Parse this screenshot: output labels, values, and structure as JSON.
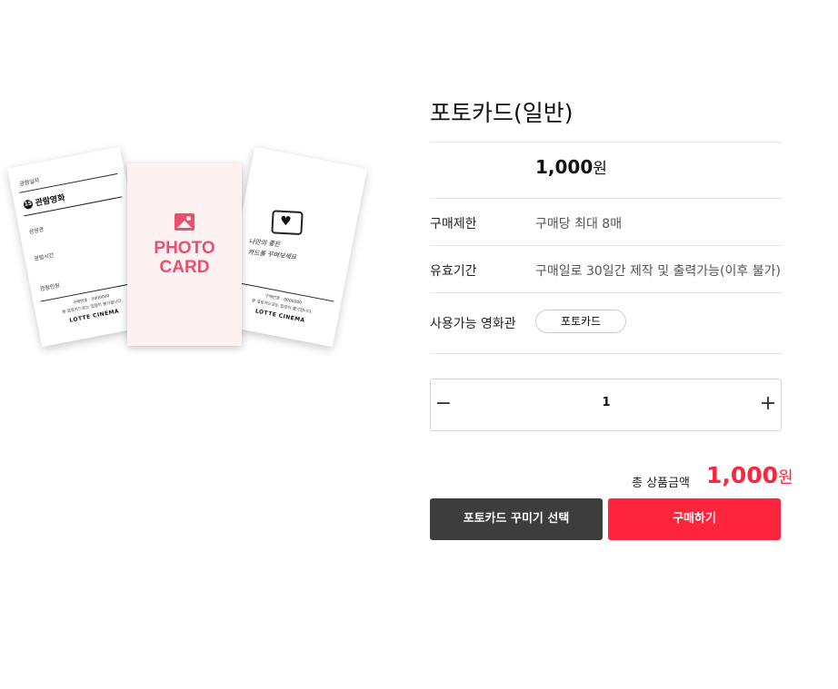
{
  "product": {
    "title": "포토카드(일반)",
    "price": "1,000",
    "price_unit": "원"
  },
  "details": [
    {
      "label": "구매제한",
      "value": "구매당 최대 8매"
    },
    {
      "label": "유효기간",
      "value": "구매일로 30일간 제작 및 출력가능(이후 불가)"
    },
    {
      "label": "사용가능 영화관",
      "chip": "포토카드"
    }
  ],
  "quantity": {
    "minus": "−",
    "value": "1",
    "plus": "+"
  },
  "total": {
    "label": "총 상품금액",
    "amount": "1,000",
    "unit": "원"
  },
  "buttons": {
    "decorate": "포토카드 꾸미기 선택",
    "buy": "구매하기"
  },
  "image": {
    "ticket": {
      "date_label": "관람일자",
      "age": "15",
      "movie": "관람영화",
      "hall_label": "상영관",
      "time_label": "관람시간",
      "seat_label": "관람인원",
      "footer_line1": "구매번호 : 0000000",
      "footer_line2": "본 포토카드로는 입장이 불가합니다.",
      "brand": "LOTTE CINEMA"
    },
    "photo_card": {
      "line1": "PHOTO",
      "line2": "CARD"
    },
    "back_card": {
      "handwriting_line1": "나만의 좋은",
      "handwriting_line2": "카드를 꾸며보세요",
      "footer_line1": "구매번호 : 0000000",
      "footer_line2": "본 포토카드로는 입장이 불가합니다.",
      "brand": "LOTTE CINEMA"
    }
  },
  "colors": {
    "accent": "#ff243e",
    "dark_button": "#3d3d3d",
    "photo_pink": "#e8506e"
  }
}
